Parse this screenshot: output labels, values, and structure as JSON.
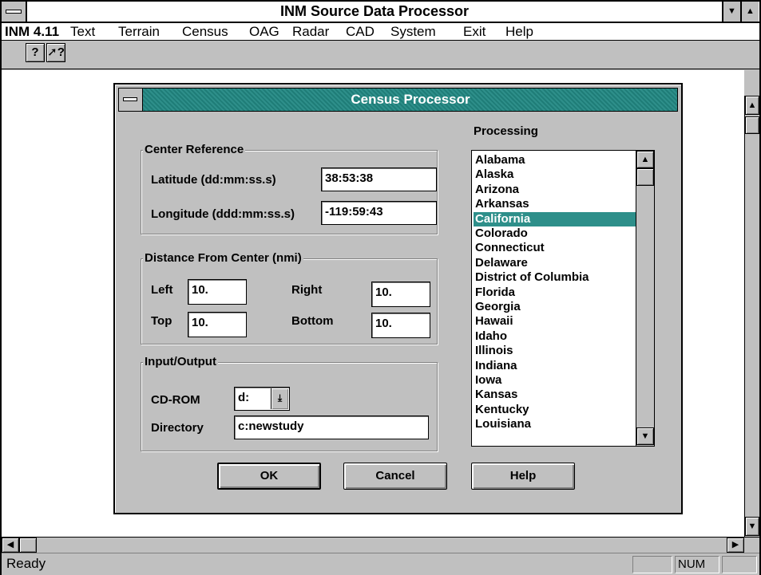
{
  "app": {
    "title": "INM Source Data Processor",
    "menu": [
      "INM 4.11",
      "Text",
      "Terrain",
      "Census",
      "OAG",
      "Radar",
      "CAD",
      "System",
      "Exit",
      "Help"
    ],
    "toolbar": {
      "help_icon": "?",
      "context_help_icon": "?"
    },
    "status": {
      "text": "Ready",
      "num": "NUM"
    }
  },
  "dialog": {
    "title": "Census Processor",
    "center_reference": {
      "label": "Center Reference",
      "latitude_label": "Latitude (dd:mm:ss.s)",
      "latitude_value": "38:53:38",
      "longitude_label": "Longitude (ddd:mm:ss.s)",
      "longitude_value": "-119:59:43"
    },
    "distance": {
      "label": "Distance From Center (nmi)",
      "left_label": "Left",
      "left_value": "10.",
      "right_label": "Right",
      "right_value": "10.",
      "top_label": "Top",
      "top_value": "10.",
      "bottom_label": "Bottom",
      "bottom_value": "10."
    },
    "io": {
      "label": "Input/Output",
      "cdrom_label": "CD-ROM",
      "cdrom_value": "d:",
      "directory_label": "Directory",
      "directory_value": "c:newstudy"
    },
    "processing": {
      "label": "Processing",
      "selected": "California",
      "items": [
        "Alabama",
        "Alaska",
        "Arizona",
        "Arkansas",
        "California",
        "Colorado",
        "Connecticut",
        "Delaware",
        "District of Columbia",
        "Florida",
        "Georgia",
        "Hawaii",
        "Idaho",
        "Illinois",
        "Indiana",
        "Iowa",
        "Kansas",
        "Kentucky",
        "Louisiana"
      ]
    },
    "buttons": {
      "ok": "OK",
      "cancel": "Cancel",
      "help": "Help"
    }
  }
}
